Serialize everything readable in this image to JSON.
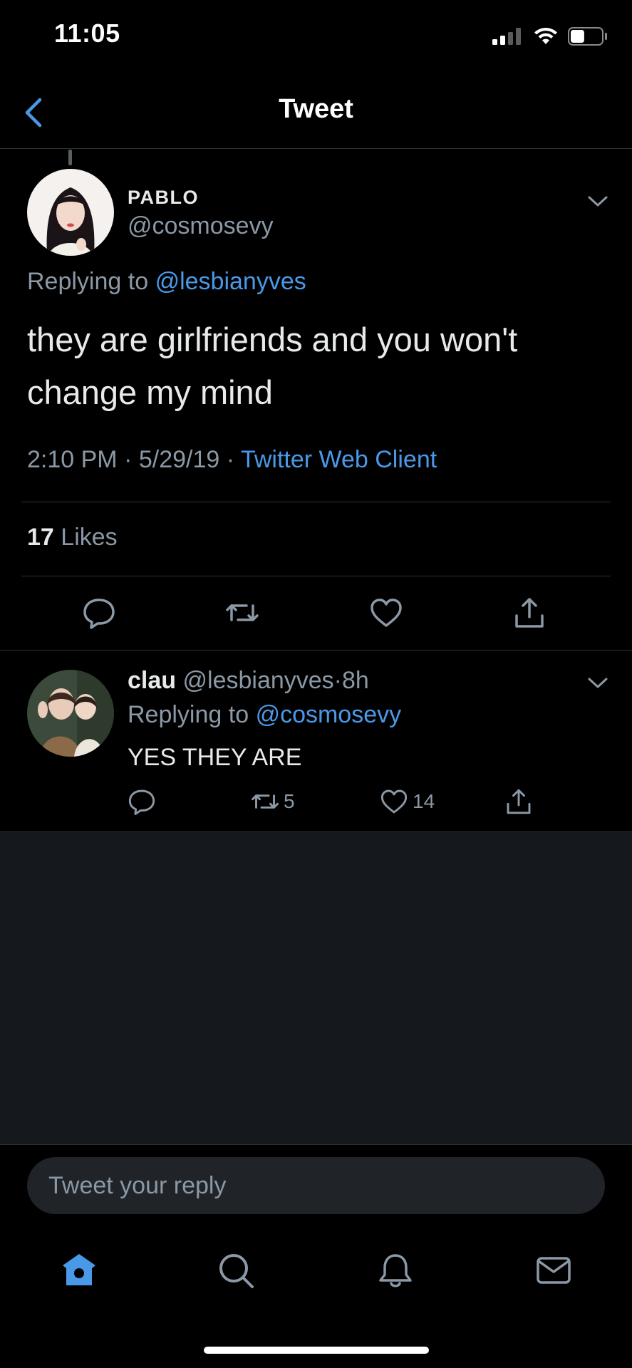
{
  "status_bar": {
    "time": "11:05",
    "battery_level": 0.45
  },
  "nav": {
    "title": "Tweet"
  },
  "tweet": {
    "display_name": "PABLO",
    "handle": "@cosmosevy",
    "replying_prefix": "Replying to",
    "replying_handle": "@lesbianyves",
    "text": "they are girlfriends and you won't change my mind",
    "time": "2:10 PM",
    "date": "5/29/19",
    "separator": "·",
    "client": "Twitter Web Client",
    "likes_count": "17",
    "likes_label": "Likes"
  },
  "reply": {
    "display_name": "clau",
    "handle": "@lesbianyves",
    "time": "8h",
    "replying_prefix": "Replying to",
    "replying_handle": "@cosmosevy",
    "text": "YES THEY ARE",
    "retweets": "5",
    "likes": "14"
  },
  "compose": {
    "placeholder": "Tweet your reply"
  },
  "tabs": [
    "home-icon",
    "search-icon",
    "bell-icon",
    "mail-icon"
  ],
  "colors": {
    "accent": "#4a99e9",
    "background": "#000000",
    "muted": "#8b98a5",
    "empty_area": "#15181c"
  }
}
